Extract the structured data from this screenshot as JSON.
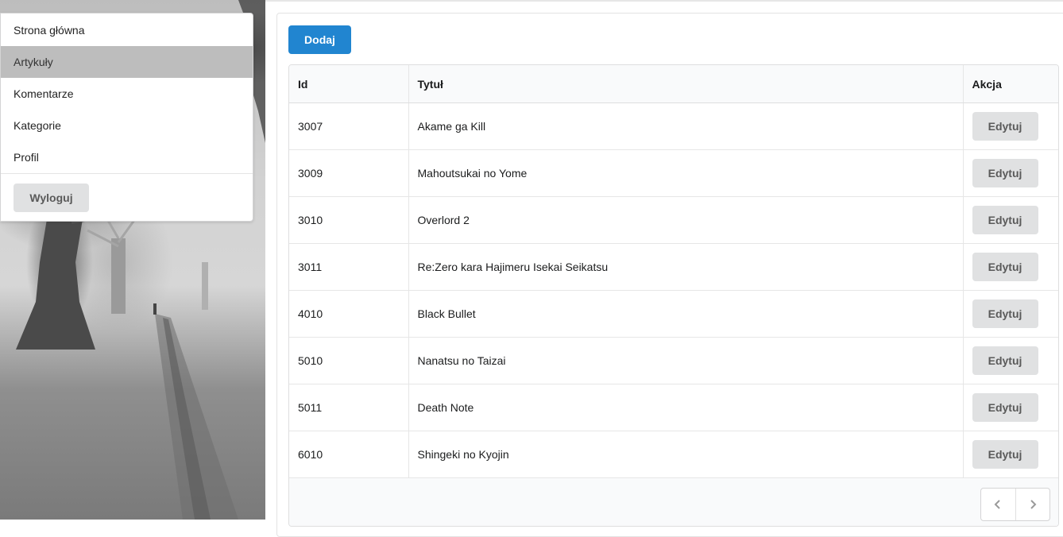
{
  "sidebar": {
    "items": [
      {
        "label": "Strona główna"
      },
      {
        "label": "Artykuły"
      },
      {
        "label": "Komentarze"
      },
      {
        "label": "Kategorie"
      },
      {
        "label": "Profil"
      }
    ],
    "active_index": 1,
    "logout_label": "Wyloguj"
  },
  "main": {
    "add_label": "Dodaj",
    "table": {
      "headers": [
        "Id",
        "Tytuł",
        "Akcja"
      ],
      "rows": [
        {
          "id": "3007",
          "title": "Akame ga Kill",
          "action": "Edytuj"
        },
        {
          "id": "3009",
          "title": "Mahoutsukai no Yome",
          "action": "Edytuj"
        },
        {
          "id": "3010",
          "title": "Overlord 2",
          "action": "Edytuj"
        },
        {
          "id": "3011",
          "title": "Re:Zero kara Hajimeru Isekai Seikatsu",
          "action": "Edytuj"
        },
        {
          "id": "4010",
          "title": "Black Bullet",
          "action": "Edytuj"
        },
        {
          "id": "5010",
          "title": "Nanatsu no Taizai",
          "action": "Edytuj"
        },
        {
          "id": "5011",
          "title": "Death Note",
          "action": "Edytuj"
        },
        {
          "id": "6010",
          "title": "Shingeki no Kyojin",
          "action": "Edytuj"
        }
      ]
    },
    "pagination": {
      "prev_icon": "chevron-left-icon",
      "next_icon": "chevron-right-icon"
    }
  },
  "colors": {
    "primary": "#2185d0",
    "active_menu_bg": "#bdbdbd",
    "button_grey": "#e0e1e2"
  }
}
